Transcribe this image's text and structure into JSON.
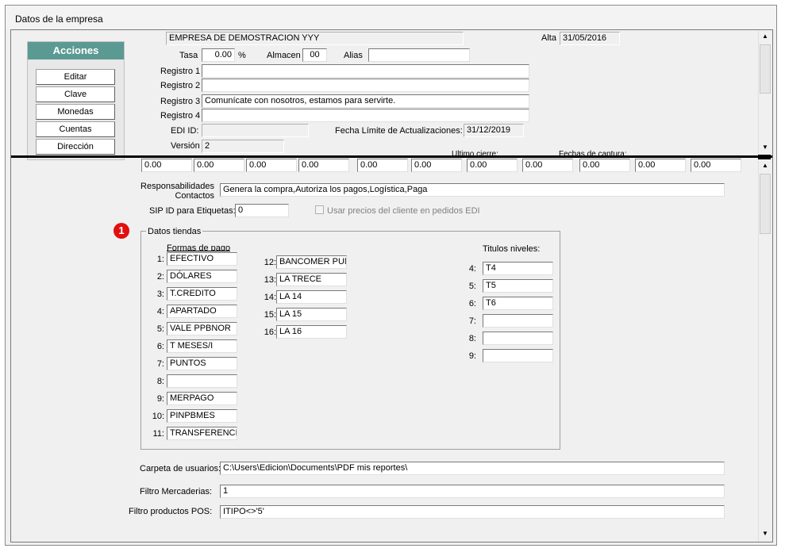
{
  "window": {
    "title": "Datos de la empresa"
  },
  "acciones": {
    "title": "Acciones",
    "buttons": [
      "Editar",
      "Clave",
      "Monedas",
      "Cuentas",
      "Dirección"
    ]
  },
  "top": {
    "company_name": "EMPRESA DE DEMOSTRACION YYY",
    "alta_label": "Alta",
    "alta_value": "31/05/2016",
    "tasa_label": "Tasa",
    "tasa_value": "0.00",
    "percent": "%",
    "almacen_label": "Almacen",
    "almacen_value": "00",
    "alias_label": "Alias",
    "alias_value": "",
    "registro1_label": "Registro 1",
    "registro1_value": "",
    "registro2_label": "Registro 2",
    "registro2_value": "",
    "registro3_label": "Registro 3",
    "registro3_value": "Comunícate con nosotros, estamos para servirte.",
    "registro4_label": "Registro 4",
    "registro4_value": "",
    "edi_label": "EDI ID:",
    "edi_value": "",
    "fecha_limite_label": "Fecha Límite de Actualizaciones:",
    "fecha_limite_value": "31/12/2019",
    "version_label": "Versión",
    "version_value": "2",
    "ultimo_cierre_label": "Ultimo cierre:",
    "fechas_captura_label": "Fechas de captura:"
  },
  "bottom": {
    "amounts": [
      "0.00",
      "0.00",
      "0.00",
      "0.00",
      "0.00",
      "0.00",
      "0.00",
      "0.00",
      "0.00",
      "0.00",
      "0.00"
    ],
    "responsabilidades_label1": "Responsabilidades",
    "responsabilidades_label2": "Contactos",
    "responsabilidades_value": "Genera la compra,Autoriza los pagos,Logística,Paga",
    "sip_label": "SIP ID para Etiquetas:",
    "sip_value": "0",
    "usar_precios_label": "Usar precios del cliente en pedidos EDI",
    "badge": "1",
    "datos_tiendas_title": "Datos tiendas",
    "formas_pago_label": "Formas de pago",
    "formas_pago": [
      {
        "n": "1:",
        "v": "EFECTIVO"
      },
      {
        "n": "2:",
        "v": "DÓLARES"
      },
      {
        "n": "3:",
        "v": "T.CREDITO"
      },
      {
        "n": "4:",
        "v": "APARTADO"
      },
      {
        "n": "5:",
        "v": "VALE PPBNOR"
      },
      {
        "n": "6:",
        "v": "T MESES/I"
      },
      {
        "n": "7:",
        "v": "PUNTOS"
      },
      {
        "n": "8:",
        "v": ""
      },
      {
        "n": "9:",
        "v": "MERPAGO"
      },
      {
        "n": "10:",
        "v": "PINPBMES"
      },
      {
        "n": "11:",
        "v": "TRANSFERENCI"
      }
    ],
    "formas_pago2": [
      {
        "n": "12:",
        "v": "BANCOMER PUN"
      },
      {
        "n": "13:",
        "v": "LA TRECE"
      },
      {
        "n": "14:",
        "v": "LA 14"
      },
      {
        "n": "15:",
        "v": "LA 15"
      },
      {
        "n": "16:",
        "v": "LA 16"
      }
    ],
    "titulos_label": "Titulos niveles:",
    "titulos": [
      {
        "n": "4:",
        "v": "T4"
      },
      {
        "n": "5:",
        "v": "T5"
      },
      {
        "n": "6:",
        "v": "T6"
      },
      {
        "n": "7:",
        "v": ""
      },
      {
        "n": "8:",
        "v": ""
      },
      {
        "n": "9:",
        "v": ""
      }
    ],
    "carpeta_label": "Carpeta de usuarios:",
    "carpeta_value": "C:\\Users\\Edicion\\Documents\\PDF mis reportes\\",
    "filtro_merc_label": "Filtro Mercaderias:",
    "filtro_merc_value": "1",
    "filtro_pos_label": "Filtro productos POS:",
    "filtro_pos_value": "ITIPO<>'5'"
  },
  "colors": {
    "acciones_header": "#5b9a92",
    "badge": "#e01010"
  },
  "icons": [
    "scroll-up-icon",
    "scroll-down-icon",
    "check-icon"
  ]
}
